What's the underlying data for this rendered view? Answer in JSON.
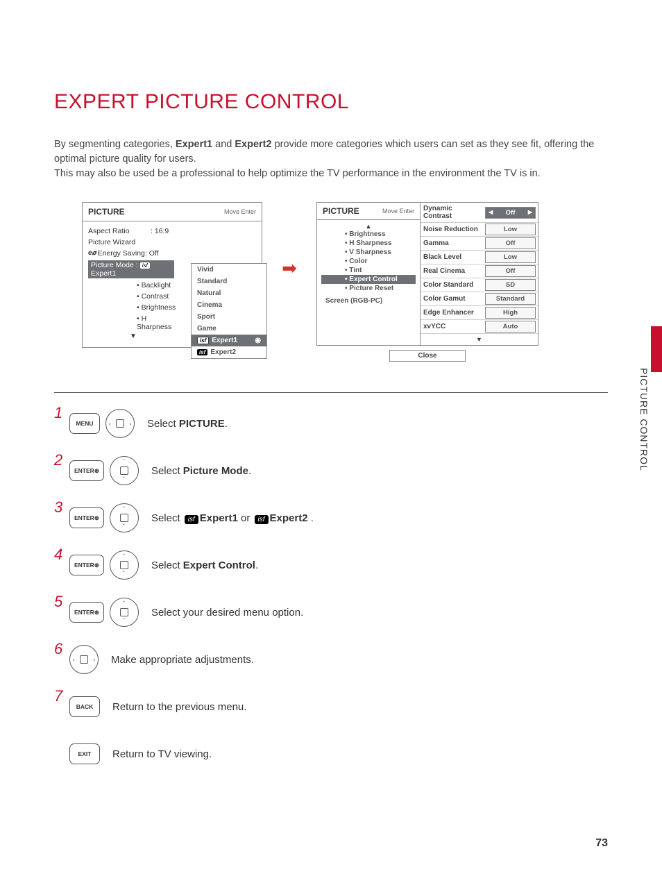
{
  "title": "EXPERT PICTURE CONTROL",
  "intro": {
    "p1a": "By segmenting categories, ",
    "p1_e1": "Expert1",
    "p1b": " and ",
    "p1_e2": "Expert2",
    "p1c": " provide more categories which users can set as they see fit, offering the optimal picture quality for users.",
    "p2": "This may also be used be a professional to help optimize the TV performance in the environment the TV is in."
  },
  "osd1": {
    "header": "PICTURE",
    "hint": "Move    Enter",
    "rows": {
      "aspect_label": "Aspect Ratio",
      "aspect_value": ": 16:9",
      "wizard": "Picture Wizard",
      "energy": "Energy Saving: Off",
      "mode_label": "Picture Mode    :",
      "mode_value": "Expert1",
      "backlight": "Backlight",
      "contrast": "Contrast",
      "brightness": "Brightness",
      "hsharp": "H Sharpness"
    },
    "dropdown": [
      "Vivid",
      "Standard",
      "Natural",
      "Cinema",
      "Sport",
      "Game"
    ],
    "dropdown_sel": "Expert1",
    "dropdown_last": "Expert2"
  },
  "osd2": {
    "header": "PICTURE",
    "hint": "Move    Enter",
    "left_items": [
      "Brightness",
      "H Sharpness",
      "V Sharpness",
      "Color",
      "Tint"
    ],
    "left_sel": "Expert Control",
    "left_after": "Picture Reset",
    "screen": "Screen (RGB-PC)",
    "right": [
      {
        "k": "Dynamic Contrast",
        "v": "Off",
        "sel": true
      },
      {
        "k": "Noise Reduction",
        "v": "Low"
      },
      {
        "k": "Gamma",
        "v": "Off"
      },
      {
        "k": "Black Level",
        "v": "Low"
      },
      {
        "k": "Real Cinema",
        "v": "Off"
      },
      {
        "k": "Color Standard",
        "v": "SD"
      },
      {
        "k": "Color Gamut",
        "v": "Standard"
      },
      {
        "k": "Edge Enhancer",
        "v": "High"
      },
      {
        "k": "xvYCC",
        "v": "Auto"
      }
    ],
    "close": "Close"
  },
  "steps": [
    {
      "n": "1",
      "btn": "MENU",
      "nav": "lr",
      "text_a": "Select ",
      "bold": "PICTURE",
      "text_b": "."
    },
    {
      "n": "2",
      "btn": "ENTER",
      "nav": "ud",
      "text_a": "Select ",
      "bold": "Picture Mode",
      "text_b": "."
    },
    {
      "n": "3",
      "btn": "ENTER",
      "nav": "ud",
      "text_a": "Select ",
      "isf1": "Expert1",
      "mid": " or ",
      "isf2": "Expert2",
      "text_b": "."
    },
    {
      "n": "4",
      "btn": "ENTER",
      "nav": "ud",
      "text_a": "Select ",
      "bold": "Expert Control",
      "text_b": "."
    },
    {
      "n": "5",
      "btn": "ENTER",
      "nav": "ud",
      "text_a": "Select your desired menu option."
    },
    {
      "n": "6",
      "nav": "lr",
      "text_a": "Make appropriate adjustments."
    },
    {
      "n": "7",
      "btn": "BACK",
      "text_a": "Return to the previous menu."
    },
    {
      "btn": "EXIT",
      "text_a": "Return to TV viewing."
    }
  ],
  "buttons": {
    "enter_sub": "⊛"
  },
  "side_tab": "PICTURE CONTROL",
  "page_number": "73"
}
